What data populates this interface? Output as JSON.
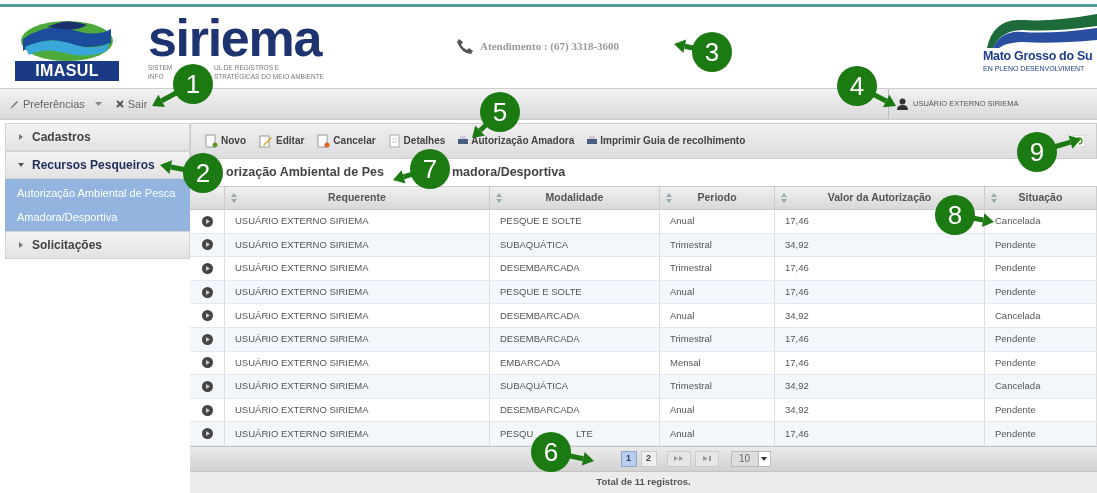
{
  "header": {
    "logo_text": "IMASUL",
    "brand": "siriema",
    "subtitle_lines": [
      [
        "SISTEM",
        "UL DE REGISTROS E"
      ],
      [
        "INFO",
        "STRATÉGICAS DO MEIO AMBIENTE"
      ]
    ],
    "contact": "Atendimento : (67) 3318-3600",
    "gov_logo_lines": [
      "Mato Grosso do Su",
      "EN PLENO DESENVOLVIMENT"
    ]
  },
  "nav": {
    "items": [
      {
        "label": "Preferências",
        "kind": "dropdown"
      },
      {
        "label": "Sair",
        "kind": "exit"
      }
    ],
    "user": "USUÁRIO EXTERNO SIRIEMA"
  },
  "sidebar": {
    "items": [
      {
        "label": "Cadastros",
        "expanded": false
      },
      {
        "label": "Recursos Pesqueiros",
        "expanded": true,
        "children": [
          {
            "label": "Autorização Ambiental de Pesca Amadora/Desportiva",
            "selected": true
          }
        ]
      },
      {
        "label": "Solicitações",
        "expanded": false
      }
    ]
  },
  "toolbar": {
    "buttons": [
      {
        "label": "Novo",
        "kind": "new"
      },
      {
        "label": "Editar",
        "kind": "edit"
      },
      {
        "label": "Cancelar",
        "kind": "cancel"
      },
      {
        "label": "Detalhes",
        "kind": "details"
      },
      {
        "label": "Autorização Amadora",
        "kind": "print"
      },
      {
        "label": "Imprimir Guia de recolhimento",
        "kind": "print"
      }
    ]
  },
  "panel_title": [
    "orização Ambiental de Pes",
    "madora/Desportiva"
  ],
  "table": {
    "columns": [
      "Requerente",
      "Modalidade",
      "Periodo",
      "Valor da Autorização",
      "Situação"
    ],
    "rows": [
      {
        "cells": [
          "USUÁRIO EXTERNO SIRIEMA",
          "PESQUE E SOLTE",
          "Anual",
          "17,46",
          "Cancelada"
        ]
      },
      {
        "cells": [
          "USUÁRIO EXTERNO SIRIEMA",
          "SUBAQUÁTICA",
          "Trimestral",
          "34,92",
          "Pendente"
        ]
      },
      {
        "cells": [
          "USUÁRIO EXTERNO SIRIEMA",
          "DESEMBARCADA",
          "Trimestral",
          "17,46",
          "Pendente"
        ]
      },
      {
        "cells": [
          "USUÁRIO EXTERNO SIRIEMA",
          "PESQUE E SOLTE",
          "Anual",
          "17,46",
          "Pendente"
        ]
      },
      {
        "cells": [
          "USUÁRIO EXTERNO SIRIEMA",
          "DESEMBARCADA",
          "Anual",
          "34,92",
          "Cancelada"
        ]
      },
      {
        "cells": [
          "USUÁRIO EXTERNO SIRIEMA",
          "DESEMBARCADA",
          "Trimestral",
          "17,46",
          "Pendente"
        ]
      },
      {
        "cells": [
          "USUÁRIO EXTERNO SIRIEMA",
          "EMBARCADA",
          "Mensal",
          "17,46",
          "Pendente"
        ]
      },
      {
        "cells": [
          "USUÁRIO EXTERNO SIRIEMA",
          "SUBAQUÁTICA",
          "Trimestral",
          "34,92",
          "Cancelada"
        ]
      },
      {
        "cells": [
          "USUÁRIO EXTERNO SIRIEMA",
          "DESEMBARCADA",
          "Anual",
          "34,92",
          "Pendente"
        ]
      },
      {
        "cells": [
          "USUÁRIO EXTERNO SIRIEMA",
          [
            "PESQU",
            "LTE"
          ],
          "Anual",
          "17,46",
          "Pendente"
        ]
      }
    ]
  },
  "pager": {
    "pages": [
      {
        "label": "1",
        "selected": true
      },
      {
        "label": "2",
        "selected": false
      }
    ],
    "page_size": "10",
    "total": "Total de 11 registros."
  },
  "callouts": [
    "1",
    "2",
    "3",
    "4",
    "5",
    "6",
    "7",
    "8",
    "9"
  ]
}
